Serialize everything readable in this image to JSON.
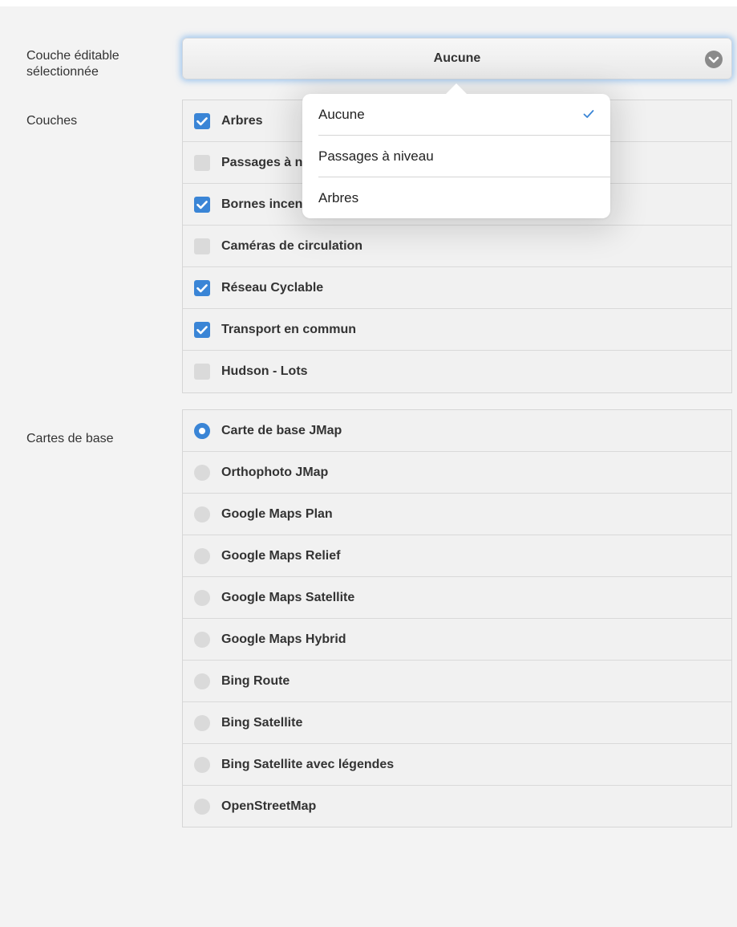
{
  "labels": {
    "editable_layer": "Couche éditable sélectionnée",
    "layers": "Couches",
    "base_maps": "Cartes de base"
  },
  "editable_select": {
    "value": "Aucune",
    "options": [
      {
        "label": "Aucune",
        "selected": true
      },
      {
        "label": "Passages à niveau",
        "selected": false
      },
      {
        "label": "Arbres",
        "selected": false
      }
    ]
  },
  "layers": [
    {
      "label": "Arbres",
      "checked": true
    },
    {
      "label": "Passages à niveau",
      "checked": false
    },
    {
      "label": "Bornes incendie",
      "checked": true
    },
    {
      "label": "Caméras de circulation",
      "checked": false
    },
    {
      "label": "Réseau Cyclable",
      "checked": true
    },
    {
      "label": "Transport en commun",
      "checked": true
    },
    {
      "label": "Hudson - Lots",
      "checked": false
    }
  ],
  "base_maps": [
    {
      "label": "Carte de base JMap",
      "selected": true
    },
    {
      "label": "Orthophoto JMap",
      "selected": false
    },
    {
      "label": "Google Maps Plan",
      "selected": false
    },
    {
      "label": "Google Maps Relief",
      "selected": false
    },
    {
      "label": "Google Maps Satellite",
      "selected": false
    },
    {
      "label": "Google Maps Hybrid",
      "selected": false
    },
    {
      "label": "Bing Route",
      "selected": false
    },
    {
      "label": "Bing Satellite",
      "selected": false
    },
    {
      "label": "Bing Satellite avec légendes",
      "selected": false
    },
    {
      "label": "OpenStreetMap",
      "selected": false
    }
  ],
  "colors": {
    "accent": "#3a85d6",
    "unchecked": "#dadada"
  }
}
